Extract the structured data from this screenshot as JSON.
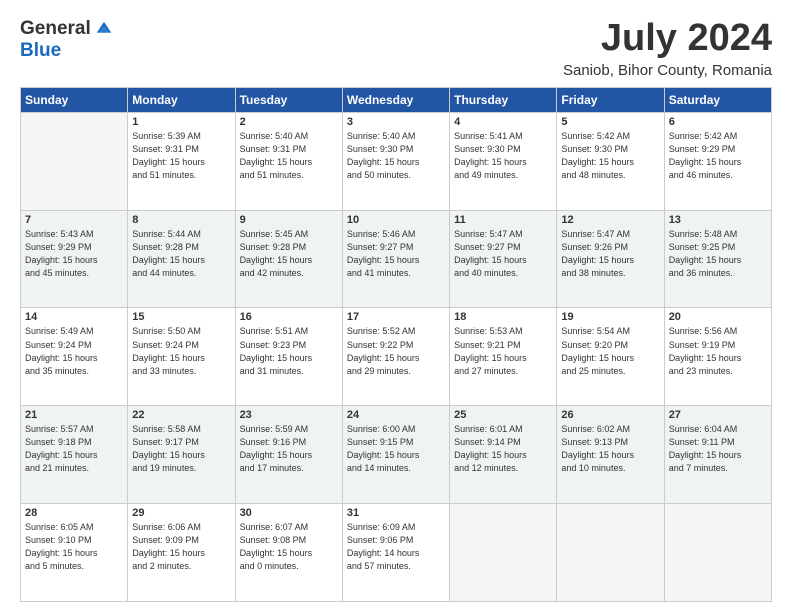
{
  "logo": {
    "general": "General",
    "blue": "Blue"
  },
  "header": {
    "month": "July 2024",
    "location": "Saniob, Bihor County, Romania"
  },
  "weekdays": [
    "Sunday",
    "Monday",
    "Tuesday",
    "Wednesday",
    "Thursday",
    "Friday",
    "Saturday"
  ],
  "weeks": [
    [
      {
        "day": "",
        "info": ""
      },
      {
        "day": "1",
        "info": "Sunrise: 5:39 AM\nSunset: 9:31 PM\nDaylight: 15 hours\nand 51 minutes."
      },
      {
        "day": "2",
        "info": "Sunrise: 5:40 AM\nSunset: 9:31 PM\nDaylight: 15 hours\nand 51 minutes."
      },
      {
        "day": "3",
        "info": "Sunrise: 5:40 AM\nSunset: 9:30 PM\nDaylight: 15 hours\nand 50 minutes."
      },
      {
        "day": "4",
        "info": "Sunrise: 5:41 AM\nSunset: 9:30 PM\nDaylight: 15 hours\nand 49 minutes."
      },
      {
        "day": "5",
        "info": "Sunrise: 5:42 AM\nSunset: 9:30 PM\nDaylight: 15 hours\nand 48 minutes."
      },
      {
        "day": "6",
        "info": "Sunrise: 5:42 AM\nSunset: 9:29 PM\nDaylight: 15 hours\nand 46 minutes."
      }
    ],
    [
      {
        "day": "7",
        "info": "Sunrise: 5:43 AM\nSunset: 9:29 PM\nDaylight: 15 hours\nand 45 minutes."
      },
      {
        "day": "8",
        "info": "Sunrise: 5:44 AM\nSunset: 9:28 PM\nDaylight: 15 hours\nand 44 minutes."
      },
      {
        "day": "9",
        "info": "Sunrise: 5:45 AM\nSunset: 9:28 PM\nDaylight: 15 hours\nand 42 minutes."
      },
      {
        "day": "10",
        "info": "Sunrise: 5:46 AM\nSunset: 9:27 PM\nDaylight: 15 hours\nand 41 minutes."
      },
      {
        "day": "11",
        "info": "Sunrise: 5:47 AM\nSunset: 9:27 PM\nDaylight: 15 hours\nand 40 minutes."
      },
      {
        "day": "12",
        "info": "Sunrise: 5:47 AM\nSunset: 9:26 PM\nDaylight: 15 hours\nand 38 minutes."
      },
      {
        "day": "13",
        "info": "Sunrise: 5:48 AM\nSunset: 9:25 PM\nDaylight: 15 hours\nand 36 minutes."
      }
    ],
    [
      {
        "day": "14",
        "info": "Sunrise: 5:49 AM\nSunset: 9:24 PM\nDaylight: 15 hours\nand 35 minutes."
      },
      {
        "day": "15",
        "info": "Sunrise: 5:50 AM\nSunset: 9:24 PM\nDaylight: 15 hours\nand 33 minutes."
      },
      {
        "day": "16",
        "info": "Sunrise: 5:51 AM\nSunset: 9:23 PM\nDaylight: 15 hours\nand 31 minutes."
      },
      {
        "day": "17",
        "info": "Sunrise: 5:52 AM\nSunset: 9:22 PM\nDaylight: 15 hours\nand 29 minutes."
      },
      {
        "day": "18",
        "info": "Sunrise: 5:53 AM\nSunset: 9:21 PM\nDaylight: 15 hours\nand 27 minutes."
      },
      {
        "day": "19",
        "info": "Sunrise: 5:54 AM\nSunset: 9:20 PM\nDaylight: 15 hours\nand 25 minutes."
      },
      {
        "day": "20",
        "info": "Sunrise: 5:56 AM\nSunset: 9:19 PM\nDaylight: 15 hours\nand 23 minutes."
      }
    ],
    [
      {
        "day": "21",
        "info": "Sunrise: 5:57 AM\nSunset: 9:18 PM\nDaylight: 15 hours\nand 21 minutes."
      },
      {
        "day": "22",
        "info": "Sunrise: 5:58 AM\nSunset: 9:17 PM\nDaylight: 15 hours\nand 19 minutes."
      },
      {
        "day": "23",
        "info": "Sunrise: 5:59 AM\nSunset: 9:16 PM\nDaylight: 15 hours\nand 17 minutes."
      },
      {
        "day": "24",
        "info": "Sunrise: 6:00 AM\nSunset: 9:15 PM\nDaylight: 15 hours\nand 14 minutes."
      },
      {
        "day": "25",
        "info": "Sunrise: 6:01 AM\nSunset: 9:14 PM\nDaylight: 15 hours\nand 12 minutes."
      },
      {
        "day": "26",
        "info": "Sunrise: 6:02 AM\nSunset: 9:13 PM\nDaylight: 15 hours\nand 10 minutes."
      },
      {
        "day": "27",
        "info": "Sunrise: 6:04 AM\nSunset: 9:11 PM\nDaylight: 15 hours\nand 7 minutes."
      }
    ],
    [
      {
        "day": "28",
        "info": "Sunrise: 6:05 AM\nSunset: 9:10 PM\nDaylight: 15 hours\nand 5 minutes."
      },
      {
        "day": "29",
        "info": "Sunrise: 6:06 AM\nSunset: 9:09 PM\nDaylight: 15 hours\nand 2 minutes."
      },
      {
        "day": "30",
        "info": "Sunrise: 6:07 AM\nSunset: 9:08 PM\nDaylight: 15 hours\nand 0 minutes."
      },
      {
        "day": "31",
        "info": "Sunrise: 6:09 AM\nSunset: 9:06 PM\nDaylight: 14 hours\nand 57 minutes."
      },
      {
        "day": "",
        "info": ""
      },
      {
        "day": "",
        "info": ""
      },
      {
        "day": "",
        "info": ""
      }
    ]
  ]
}
